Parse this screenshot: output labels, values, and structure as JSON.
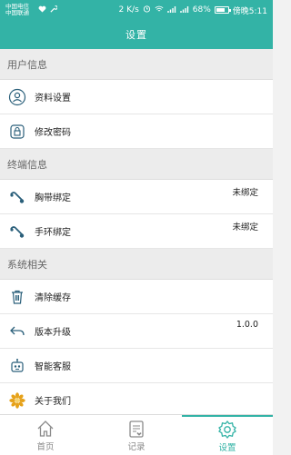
{
  "status_bar": {
    "carrier_1": "中国电信",
    "carrier_2": "中国联通",
    "speed": "2 K/s",
    "battery": "68%",
    "time": "傍晚5:11"
  },
  "header": {
    "title": "设置"
  },
  "sections": [
    {
      "title": "用户信息",
      "items": [
        {
          "label": "资料设置",
          "value": "",
          "icon": "user-icon"
        },
        {
          "label": "修改密码",
          "value": "",
          "icon": "lock-icon"
        }
      ]
    },
    {
      "title": "终端信息",
      "items": [
        {
          "label": "胸带绑定",
          "value": "未绑定",
          "icon": "chest-strap-icon"
        },
        {
          "label": "手环绑定",
          "value": "未绑定",
          "icon": "wristband-icon"
        }
      ]
    },
    {
      "title": "系统相关",
      "items": [
        {
          "label": "清除缓存",
          "value": "",
          "icon": "trash-icon"
        },
        {
          "label": "版本升级",
          "value": "1.0.0",
          "icon": "upgrade-icon"
        },
        {
          "label": "智能客服",
          "value": "",
          "icon": "robot-icon"
        },
        {
          "label": "关于我们",
          "value": "",
          "icon": "flower-icon"
        }
      ]
    }
  ],
  "tabbar": {
    "tabs": [
      {
        "label": "首页",
        "icon": "home-icon",
        "active": false
      },
      {
        "label": "记录",
        "icon": "record-icon",
        "active": false
      },
      {
        "label": "设置",
        "icon": "gear-icon",
        "active": true
      }
    ]
  },
  "colors": {
    "accent": "#33b3a6",
    "icon_stroke": "#2a5f7a"
  }
}
